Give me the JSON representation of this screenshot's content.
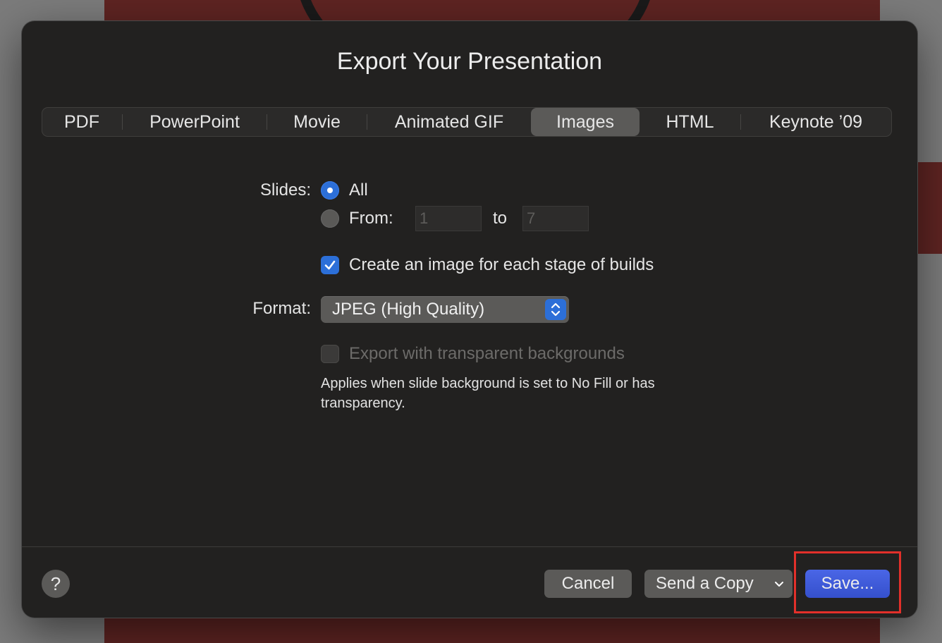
{
  "dialog": {
    "title": "Export Your Presentation"
  },
  "tabs": [
    {
      "label": "PDF",
      "active": false
    },
    {
      "label": "PowerPoint",
      "active": false
    },
    {
      "label": "Movie",
      "active": false
    },
    {
      "label": "Animated GIF",
      "active": false
    },
    {
      "label": "Images",
      "active": true
    },
    {
      "label": "HTML",
      "active": false
    },
    {
      "label": "Keynote ’09",
      "active": false
    }
  ],
  "slides": {
    "label": "Slides:",
    "all_label": "All",
    "all_selected": true,
    "from_label": "From:",
    "from_value": "1",
    "to_label": "to",
    "to_value": "7"
  },
  "builds": {
    "label": "Create an image for each stage of builds",
    "checked": true
  },
  "format": {
    "label": "Format:",
    "value": "JPEG (High Quality)"
  },
  "transparent": {
    "label": "Export with transparent backgrounds",
    "checked": false,
    "enabled": false,
    "note": "Applies when slide background is set to No Fill or has transparency."
  },
  "footer": {
    "help_label": "?",
    "cancel_label": "Cancel",
    "send_copy_label": "Send a Copy",
    "save_label": "Save..."
  },
  "colors": {
    "accent": "#2c6fd8",
    "primary_button": "#3c57d8",
    "highlight": "#e2302a"
  }
}
